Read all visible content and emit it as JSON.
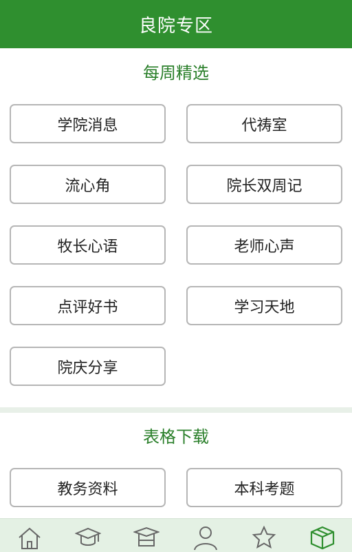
{
  "header": {
    "title": "良院专区"
  },
  "weekly": {
    "title": "每周精选",
    "items": [
      {
        "label": "学院消息"
      },
      {
        "label": "代祷室"
      },
      {
        "label": "流心角"
      },
      {
        "label": "院长双周记"
      },
      {
        "label": "牧长心语"
      },
      {
        "label": "老师心声"
      },
      {
        "label": "点评好书"
      },
      {
        "label": "学习天地"
      },
      {
        "label": "院庆分享"
      }
    ]
  },
  "forms": {
    "title": "表格下载",
    "items": [
      {
        "label": "教务资料"
      },
      {
        "label": "本科考题"
      }
    ]
  },
  "tabbar": {
    "icons": [
      "home-icon",
      "graduation-cap-icon",
      "mortarboard-icon",
      "user-icon",
      "star-icon",
      "box-icon"
    ],
    "active_color": "#2f8f2f"
  }
}
